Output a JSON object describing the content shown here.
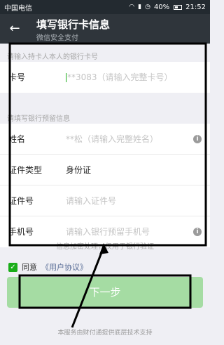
{
  "status_bar": {
    "carrier": "中国电信",
    "battery": "40%",
    "time": "21:52",
    "icons": [
      "wifi-icon",
      "signal-icon",
      "alarm-icon",
      "battery-icon"
    ]
  },
  "header": {
    "title": "填写银行卡信息",
    "subtitle": "微信安全支付"
  },
  "form": {
    "section1_hint": "请输入持卡人本人的银行卡号",
    "card_label": "卡号",
    "card_placeholder": "**3083（请输入完整卡号）",
    "section2_hint": "请填写银行预留信息",
    "rows": [
      {
        "label": "姓名",
        "value": "**松（请输入完整姓名）",
        "filled": false,
        "info": true
      },
      {
        "label": "证件类型",
        "value": "身份证",
        "filled": true,
        "info": false
      },
      {
        "label": "证件号",
        "value": "请输入证件号",
        "filled": false,
        "info": false
      },
      {
        "label": "手机号",
        "value": "请输入银行预留手机号",
        "filled": false,
        "info": true
      }
    ]
  },
  "notice": "信息加密处理，仅用于银行验证",
  "agreement": {
    "label": "同意",
    "link": "《用户协议》"
  },
  "next_button": "下一步",
  "footer": "本服务由财付通提供底层技术支持",
  "colors": {
    "accent": "#1aad19",
    "button_disabled": "#a5dca3",
    "header_bg": "#2f353b",
    "link": "#576b95"
  }
}
